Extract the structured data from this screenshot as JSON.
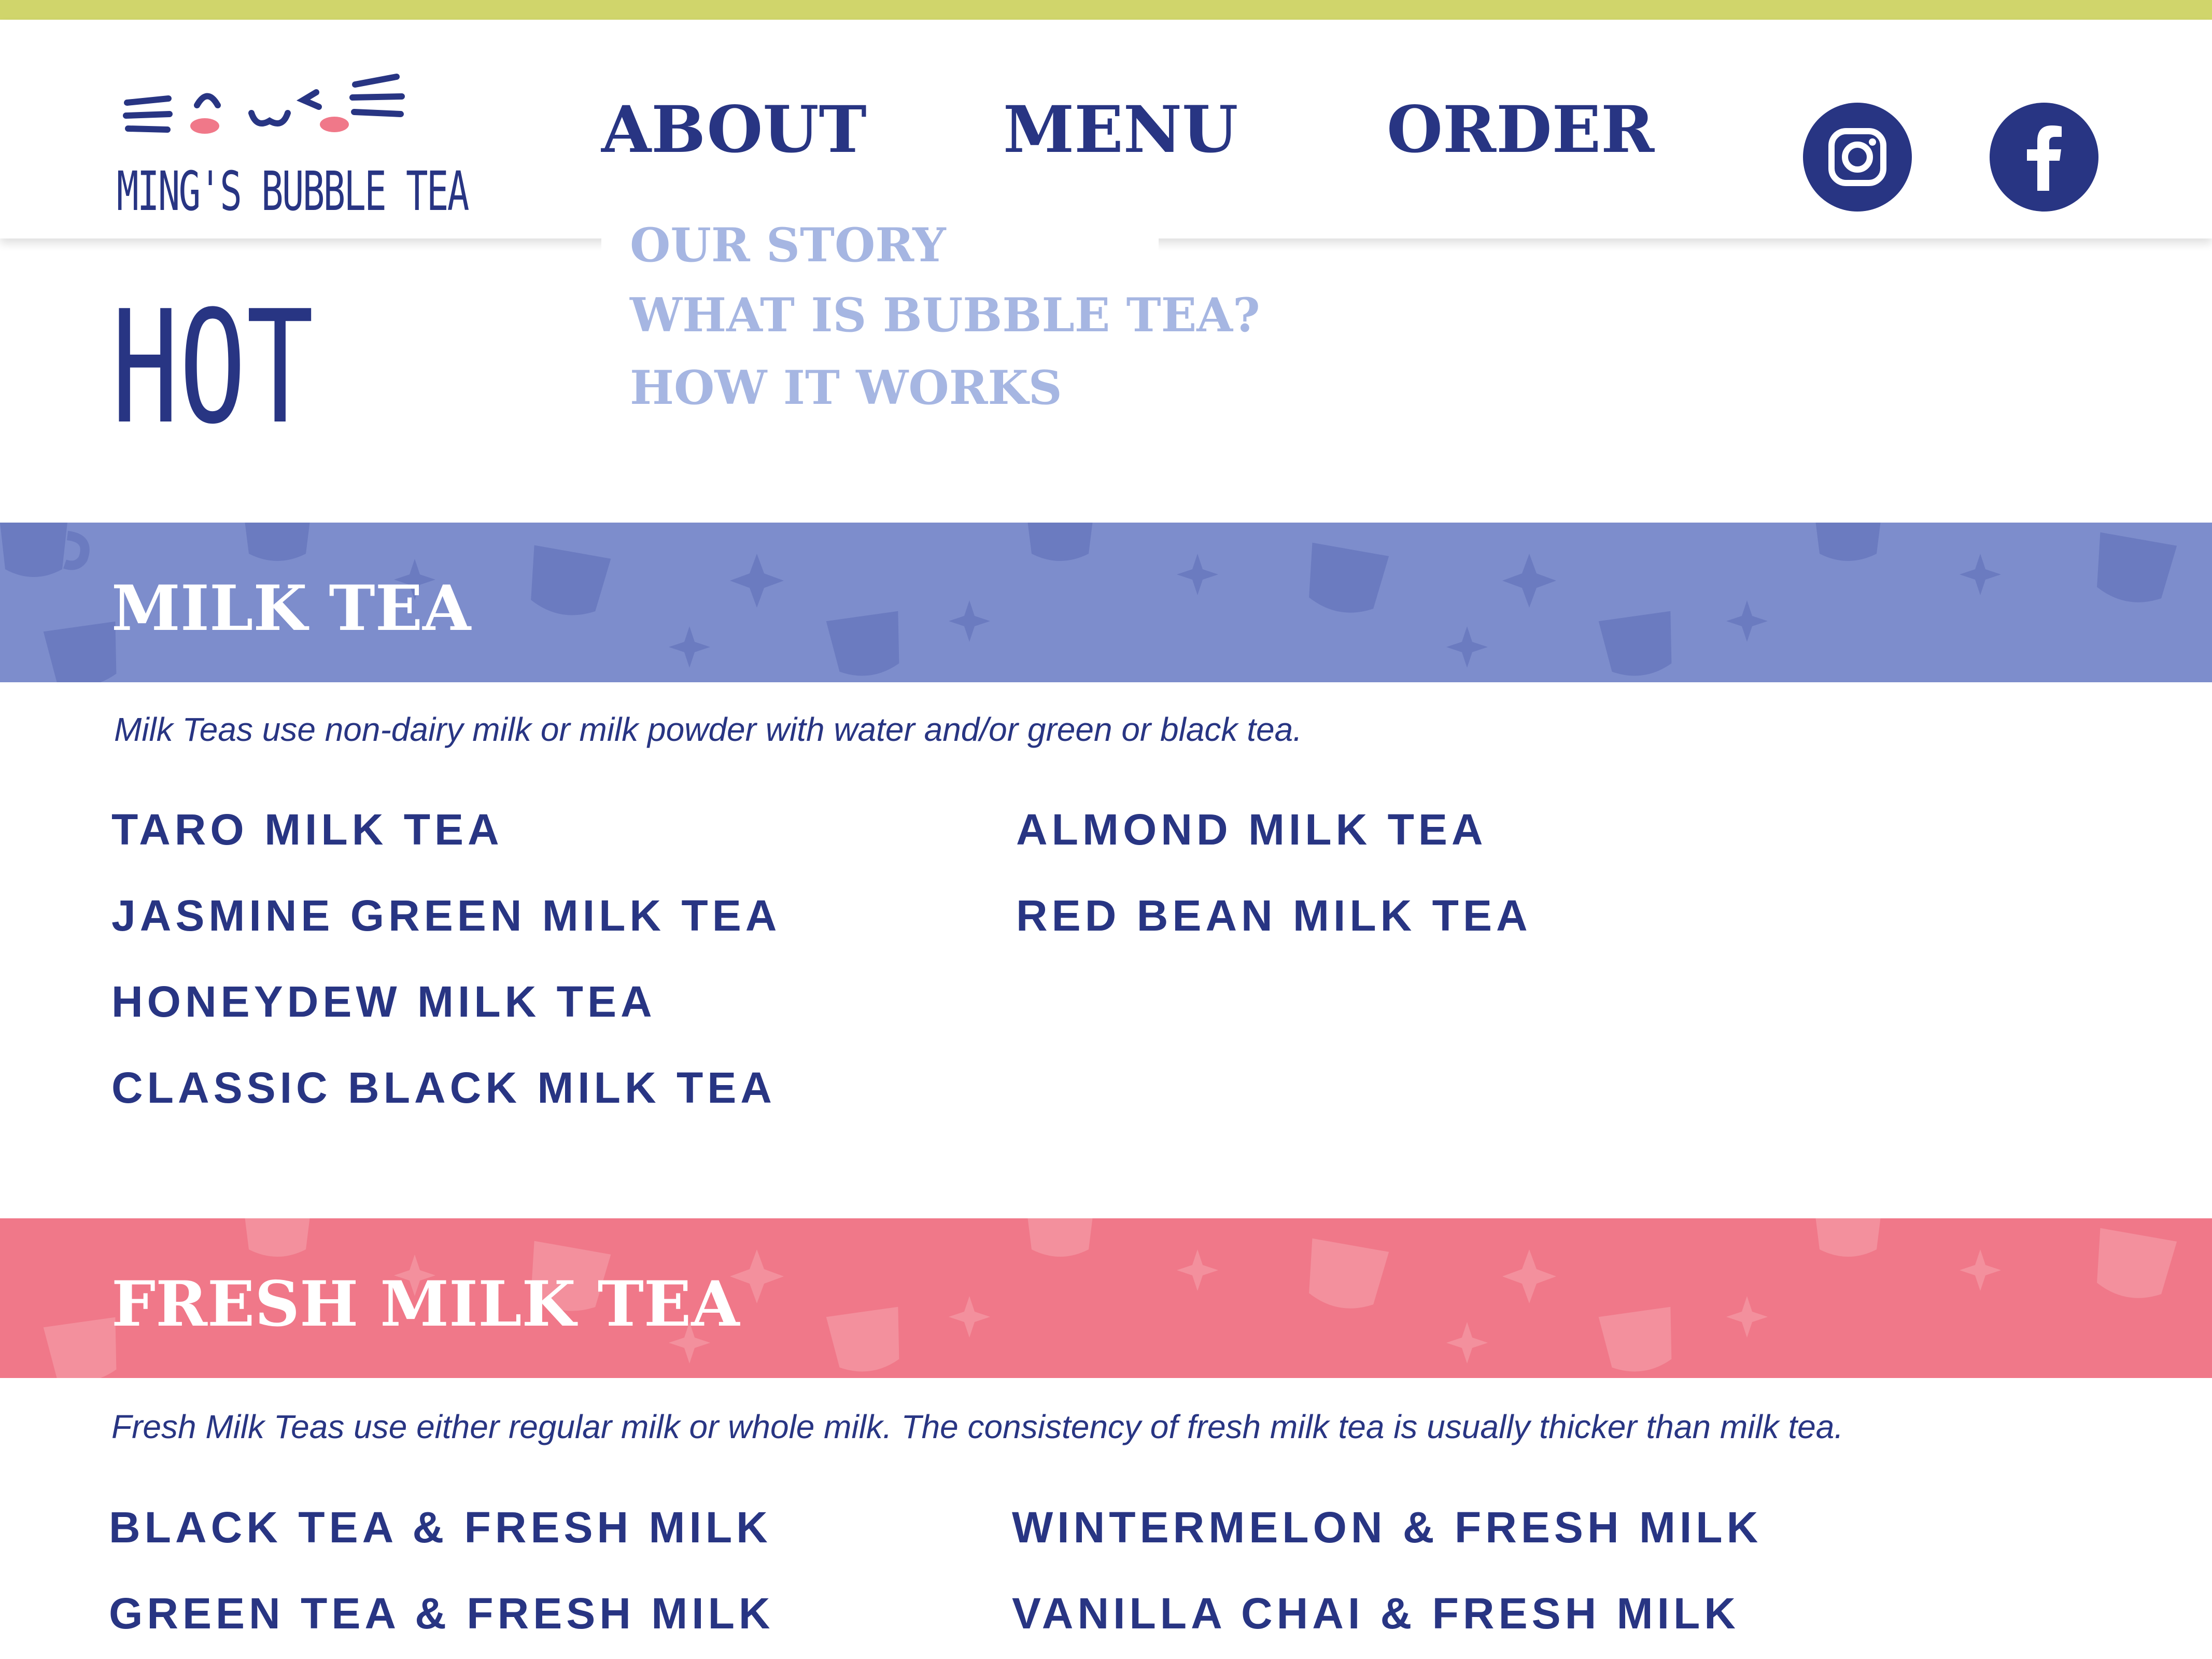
{
  "brand": {
    "name": "MING'S BUBBLE TEA",
    "accent_color": "#283583",
    "stripe_color": "#d0d56b"
  },
  "nav": {
    "about": "ABOUT",
    "menu": "MENU",
    "order": "ORDER",
    "about_dropdown": [
      "OUR STORY",
      "WHAT IS BUBBLE TEA?",
      "HOW IT WORKS"
    ]
  },
  "social": {
    "instagram_icon": "instagram-icon",
    "facebook_icon": "facebook-icon"
  },
  "page": {
    "category_title": "HOT"
  },
  "sections": [
    {
      "title": "MILK TEA",
      "band_color": "#7d8dcc",
      "description": "Milk Teas use non-dairy milk or milk powder with water and/or green or black tea.",
      "items_left": [
        "TARO MILK TEA",
        "JASMINE GREEN MILK TEA",
        "HONEYDEW MILK TEA",
        "CLASSIC BLACK MILK TEA"
      ],
      "items_right": [
        "ALMOND MILK TEA",
        "RED BEAN MILK TEA"
      ]
    },
    {
      "title": "FRESH MILK TEA",
      "band_color": "#f07889",
      "description": "Fresh Milk Teas use either regular milk or whole milk. The consistency of fresh milk tea is usually thicker than milk tea.",
      "items_left": [
        "BLACK TEA & FRESH MILK",
        "GREEN TEA & FRESH MILK"
      ],
      "items_right": [
        "WINTERMELON & FRESH MILK",
        "VANILLA CHAI & FRESH MILK"
      ]
    }
  ]
}
